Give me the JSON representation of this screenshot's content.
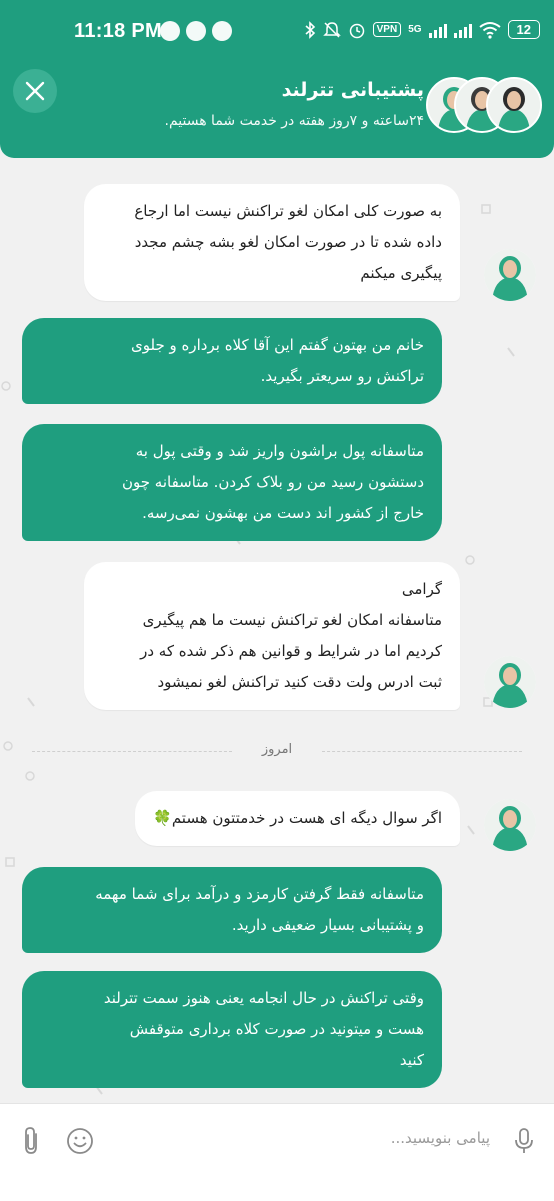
{
  "status_bar": {
    "time": "11:18 PM",
    "vpn": "VPN",
    "network": "5G",
    "battery": "12"
  },
  "header": {
    "title": "پشتیبانی تترلند",
    "subtitle": "۲۴ساعته و ۷روز هفته در خدمت شما هستیم."
  },
  "messages": [
    {
      "side": "in",
      "text": "به صورت کلی امکان لغو تراکنش نیست اما ارجاع\nداده شده تا در صورت امکان لغو بشه چشم مجدد\nپیگیری میکنم"
    },
    {
      "side": "out",
      "text": "خانم من بهتون گفتم این آقا کلاه برداره و جلوی\nتراکنش رو سریعتر بگیرید."
    },
    {
      "side": "out",
      "text": "متاسفانه پول براشون واریز شد و وقتی پول به\nدستشون رسید من رو بلاک کردن. متاسفانه چون\nخارج از کشور اند دست من بهشون نمی‌رسه."
    },
    {
      "side": "in",
      "text": "گرامی\nمتاسفانه امکان لغو تراکنش نیست ما هم پیگیری\nکردیم اما در شرایط و قوانین هم ذکر شده که در\nثبت ادرس ولت دقت کنید تراکنش لغو نمیشود"
    },
    {
      "side": "in",
      "text": "اگر سوال دیگه ای هست در خدمتتون هستم🍀"
    },
    {
      "side": "out",
      "text": "متاسفانه فقط گرفتن کارمزد و درآمد برای شما مهمه\nو پشتیبانی بسیار ضعیفی دارید."
    },
    {
      "side": "out",
      "text": "وقتی تراکنش در حال انجامه یعنی هنوز سمت تترلند\nهست و میتونید در صورت کلاه برداری متوقفش\nکنید"
    }
  ],
  "date_separator": "امروز",
  "composer": {
    "placeholder": "پیامی بنویسید..."
  },
  "colors": {
    "brand": "#1f9e7f",
    "background": "#f1f1f1",
    "incoming_bubble": "#ffffff"
  },
  "icons": [
    "close-icon",
    "attach-icon",
    "emoji-icon",
    "mic-icon",
    "bluetooth-icon",
    "wifi-icon",
    "signal-icon"
  ]
}
